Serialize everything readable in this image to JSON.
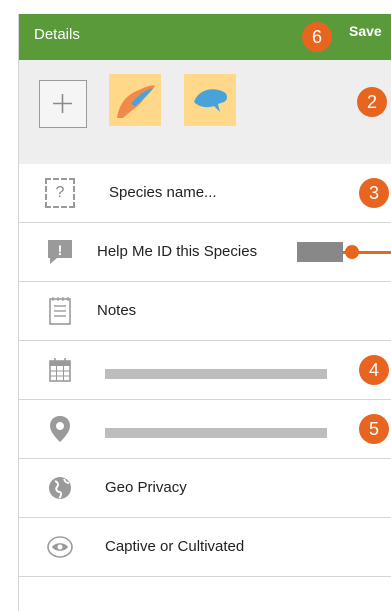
{
  "header": {
    "title": "Details",
    "save_label": "Save"
  },
  "callouts": {
    "header": "6",
    "photos": "2",
    "species": "3",
    "date": "4",
    "location": "5"
  },
  "photos": {
    "add_symbol": "+"
  },
  "species": {
    "placeholder": "Species name...",
    "icon_text": "?"
  },
  "help_id": {
    "label": "Help Me ID this Species",
    "icon_text": "!"
  },
  "notes": {
    "label": "Notes"
  },
  "geo_privacy": {
    "label": "Geo Privacy"
  },
  "captive": {
    "label": "Captive or Cultivated"
  },
  "colors": {
    "header_green": "#5a9a3a",
    "callout_orange": "#e8651f",
    "thumb_yellow": "#ffd889",
    "thumb_shape_blue": "#4aa3d8"
  },
  "icons": [
    "add-photo-icon",
    "species-unknown-icon",
    "speech-bubble-icon",
    "notes-icon",
    "calendar-icon",
    "location-pin-icon",
    "globe-icon",
    "eye-icon"
  ]
}
